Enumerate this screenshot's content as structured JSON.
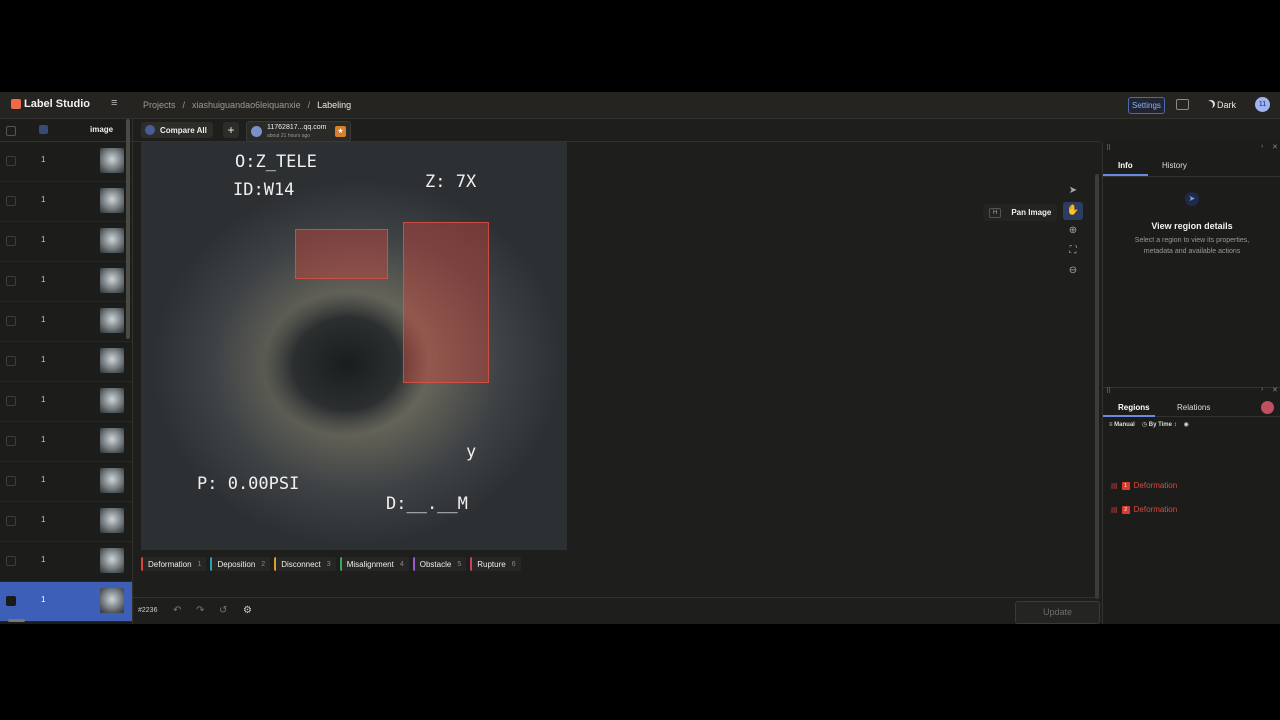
{
  "app": {
    "name": "Label Studio"
  },
  "breadcrumb": [
    "Projects",
    "xiashuiguandao6leiquanxie",
    "Labeling"
  ],
  "header": {
    "settings": "Settings",
    "theme": "Dark",
    "user_initials": "11"
  },
  "list": {
    "column": "image",
    "rows": [
      "1",
      "1",
      "1",
      "1",
      "1",
      "1",
      "1",
      "1",
      "1",
      "1",
      "1",
      "1"
    ],
    "active_index": 11
  },
  "tabs": {
    "compare": "Compare All",
    "add": "+",
    "annotator": "11762817...qq.com",
    "annotator_time": "about 21 hours ago"
  },
  "image_overlay": {
    "line1": "O:Z_TELE",
    "line2": "ID:W14",
    "zoom": "Z:  7X",
    "pressure": "P: 0.00PSI",
    "distance": "D:__.__M",
    "y": "y"
  },
  "tool": {
    "tooltip_key": "H",
    "tooltip": "Pan Image"
  },
  "labels": [
    {
      "name": "Deformation",
      "key": "1",
      "color": "#d9453a"
    },
    {
      "name": "Deposition",
      "key": "2",
      "color": "#2aa0b8"
    },
    {
      "name": "Disconnect",
      "key": "3",
      "color": "#d8a02a"
    },
    {
      "name": "Misalignment",
      "key": "4",
      "color": "#3aa85a"
    },
    {
      "name": "Obstacle",
      "key": "5",
      "color": "#9a5ad0"
    },
    {
      "name": "Rupture",
      "key": "6",
      "color": "#d0405a"
    }
  ],
  "bottom": {
    "task": "#2236",
    "update": "Update"
  },
  "info_panel": {
    "tabs": [
      "Info",
      "History"
    ],
    "title": "View region details",
    "text": "Select a region to view its properties, metadata and available actions"
  },
  "regions_panel": {
    "tabs": [
      "Regions",
      "Relations"
    ],
    "manual": "Manual",
    "sort": "By Time",
    "regions": [
      {
        "label": "Deformation",
        "index": "1"
      },
      {
        "label": "Deformation",
        "index": "2"
      }
    ]
  }
}
